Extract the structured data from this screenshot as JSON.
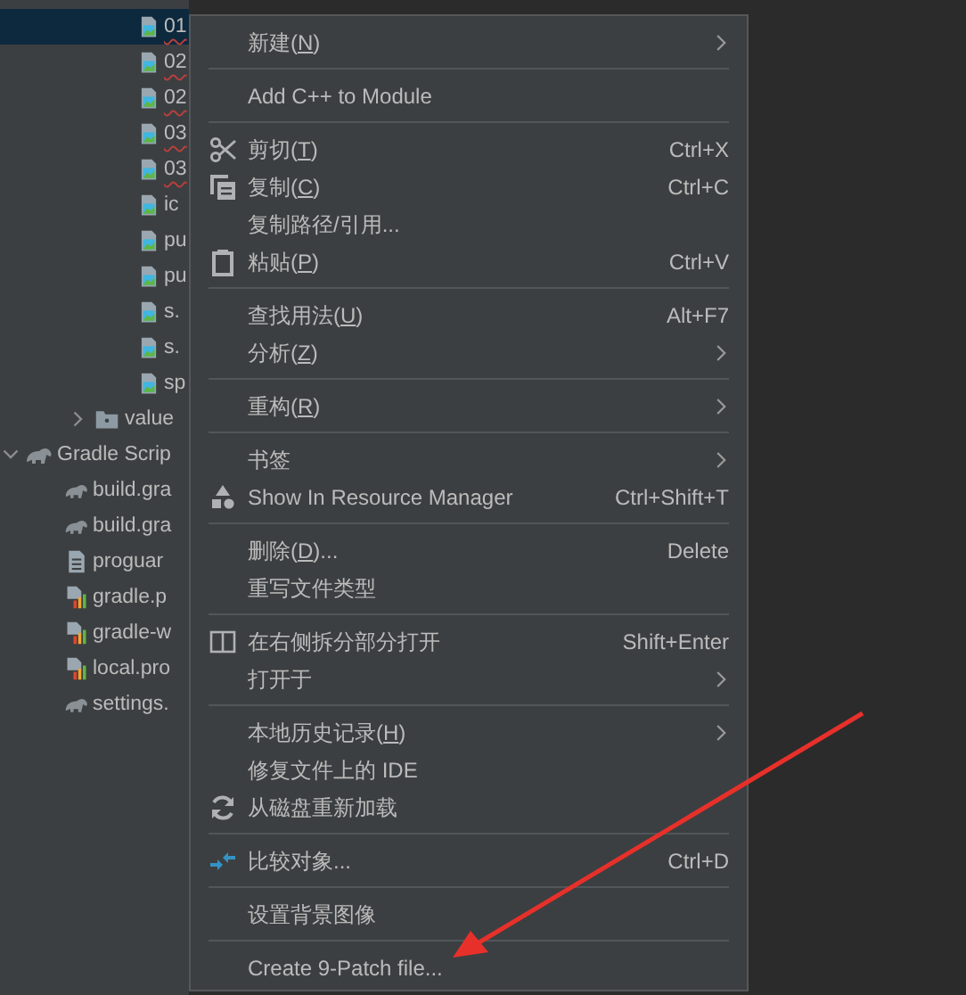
{
  "tree": {
    "files": [
      {
        "label": "01",
        "kind": "image",
        "selected": true,
        "typo": true
      },
      {
        "label": "02",
        "kind": "image",
        "selected": false,
        "typo": true
      },
      {
        "label": "02",
        "kind": "image",
        "selected": false,
        "typo": true
      },
      {
        "label": "03",
        "kind": "image",
        "selected": false,
        "typo": true
      },
      {
        "label": "03",
        "kind": "image",
        "selected": false,
        "typo": true
      },
      {
        "label": "ic",
        "kind": "image",
        "selected": false,
        "typo": false
      },
      {
        "label": "pu",
        "kind": "image",
        "selected": false,
        "typo": false
      },
      {
        "label": "pu",
        "kind": "image",
        "selected": false,
        "typo": false
      },
      {
        "label": "s.",
        "kind": "image",
        "selected": false,
        "typo": false
      },
      {
        "label": "s.",
        "kind": "image",
        "selected": false,
        "typo": false
      },
      {
        "label": "sp",
        "kind": "image",
        "selected": false,
        "typo": false
      }
    ],
    "folders": [
      {
        "label": "value",
        "expanded": false,
        "selected": false
      }
    ],
    "roots": [
      {
        "label": "Gradle Scrip",
        "expanded": true,
        "selected": false,
        "children": [
          {
            "label": "build.gra",
            "kind": "gradle",
            "selected": false
          },
          {
            "label": "build.gra",
            "kind": "gradle",
            "selected": false
          },
          {
            "label": "proguar",
            "kind": "text",
            "selected": false
          },
          {
            "label": "gradle.p",
            "kind": "properties",
            "selected": false
          },
          {
            "label": "gradle-w",
            "kind": "properties",
            "selected": false
          },
          {
            "label": "local.pro",
            "kind": "properties",
            "selected": false
          },
          {
            "label": "settings.",
            "kind": "gradle",
            "selected": false
          }
        ]
      }
    ]
  },
  "context_menu": [
    {
      "kind": "plain",
      "label": "新建(",
      "mnemonic": "N",
      "label_end": ")",
      "submenu": true
    },
    {
      "kind": "separator"
    },
    {
      "kind": "plain",
      "label": "Add C++ to Module",
      "submenu": false
    },
    {
      "kind": "separator"
    },
    {
      "kind": "cut",
      "label": "剪切(",
      "mnemonic": "T",
      "label_end": ")",
      "shortcut": "Ctrl+X",
      "submenu": false
    },
    {
      "kind": "copy",
      "label": "复制(",
      "mnemonic": "C",
      "label_end": ")",
      "shortcut": "Ctrl+C",
      "submenu": false
    },
    {
      "kind": "plain",
      "label": "复制路径/引用...",
      "submenu": false
    },
    {
      "kind": "paste",
      "label": "粘贴(",
      "mnemonic": "P",
      "label_end": ")",
      "shortcut": "Ctrl+V",
      "submenu": false
    },
    {
      "kind": "separator"
    },
    {
      "kind": "plain",
      "label": "查找用法(",
      "mnemonic": "U",
      "label_end": ")",
      "shortcut": "Alt+F7",
      "submenu": false
    },
    {
      "kind": "plain",
      "label": "分析(",
      "mnemonic": "Z",
      "label_end": ")",
      "submenu": true
    },
    {
      "kind": "separator"
    },
    {
      "kind": "plain",
      "label": "重构(",
      "mnemonic": "R",
      "label_end": ")",
      "submenu": true
    },
    {
      "kind": "separator"
    },
    {
      "kind": "plain",
      "label": "书签",
      "submenu": true
    },
    {
      "kind": "resource",
      "label": "Show In Resource Manager",
      "shortcut": "Ctrl+Shift+T",
      "submenu": false
    },
    {
      "kind": "separator"
    },
    {
      "kind": "plain",
      "label": "删除(",
      "mnemonic": "D",
      "label_end": ")...",
      "shortcut": "Delete",
      "submenu": false
    },
    {
      "kind": "plain",
      "label": "重写文件类型",
      "submenu": false
    },
    {
      "kind": "separator"
    },
    {
      "kind": "split",
      "label": "在右侧拆分部分打开",
      "shortcut": "Shift+Enter",
      "submenu": false
    },
    {
      "kind": "plain",
      "label": "打开于",
      "submenu": true
    },
    {
      "kind": "separator"
    },
    {
      "kind": "plain",
      "label": "本地历史记录(",
      "mnemonic": "H",
      "label_end": ")",
      "submenu": true
    },
    {
      "kind": "plain",
      "label": "修复文件上的 IDE",
      "submenu": false
    },
    {
      "kind": "reload",
      "label": "从磁盘重新加载",
      "submenu": false
    },
    {
      "kind": "separator"
    },
    {
      "kind": "compare",
      "label": "比较对象...",
      "shortcut": "Ctrl+D",
      "submenu": false
    },
    {
      "kind": "separator"
    },
    {
      "kind": "plain",
      "label": "设置背景图像",
      "submenu": false
    },
    {
      "kind": "separator"
    },
    {
      "kind": "plain",
      "label": "Create 9-Patch file...",
      "submenu": false
    }
  ]
}
